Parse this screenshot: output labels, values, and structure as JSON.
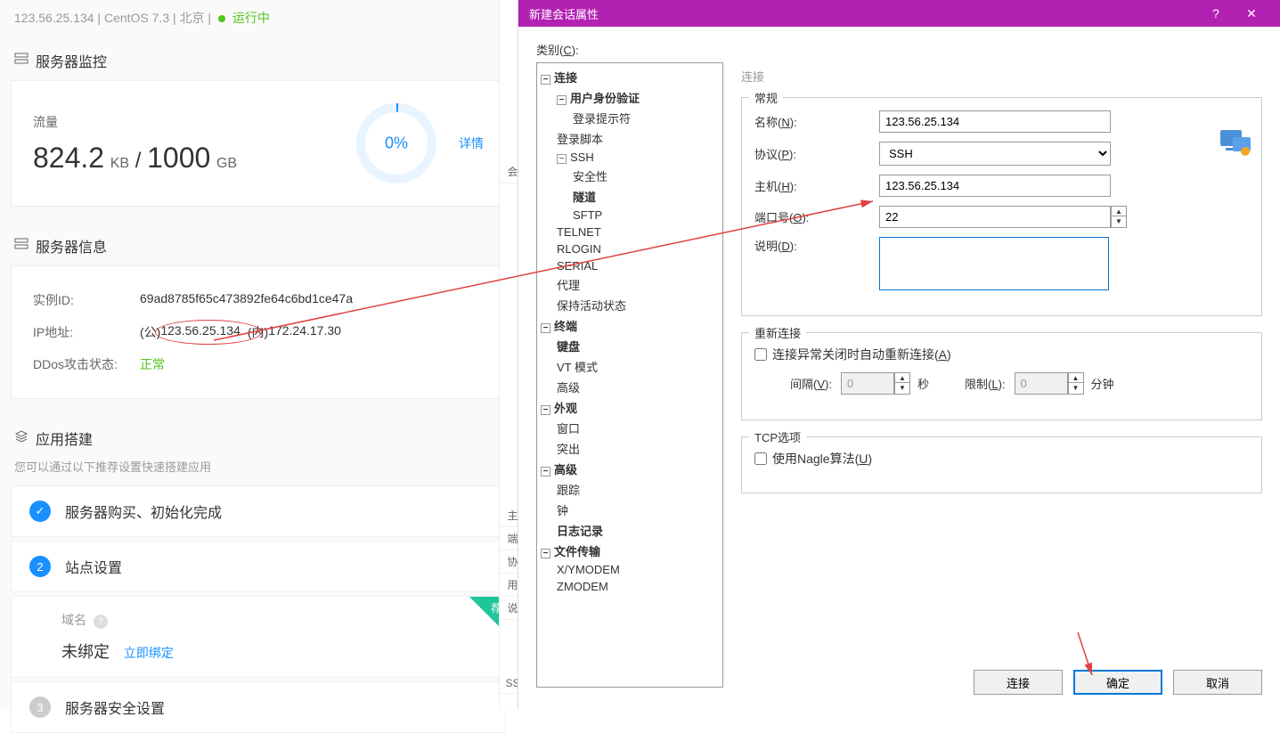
{
  "server_header": {
    "ip": "123.56.25.134",
    "os": "CentOS 7.3",
    "region": "北京",
    "status": "运行中"
  },
  "sections": {
    "monitor": "服务器监控",
    "info": "服务器信息",
    "build": "应用搭建"
  },
  "traffic": {
    "label": "流量",
    "used": "824.2",
    "used_unit": "KB",
    "slash": "/",
    "total": "1000",
    "total_unit": "GB",
    "percent": "0%",
    "detail_link": "详情"
  },
  "info": {
    "instance_id_label": "实例ID:",
    "instance_id": "69ad8785f65c473892fe64c6bd1ce47a",
    "ip_label": "IP地址:",
    "ip_public_prefix": "(公)",
    "ip_public": "123.56.25.134",
    "ip_private_prefix": "(内)",
    "ip_private": "172.24.17.30",
    "ddos_label": "DDos攻击状态:",
    "ddos_status": "正常"
  },
  "build": {
    "hint": "您可以通过以下推荐设置快速搭建应用",
    "step1": "服务器购买、初始化完成",
    "step2": "站点设置",
    "step3": "服务器安全设置",
    "domain_label": "域名",
    "unbound": "未绑定",
    "bind_link": "立即绑定",
    "badge": "荐"
  },
  "peek_items": [
    "会",
    "主",
    "端",
    "协",
    "用",
    "说",
    "SS"
  ],
  "dialog": {
    "title": "新建会话属性",
    "category_label": "类别(C):",
    "tree": {
      "connection": "连接",
      "auth": "用户身份验证",
      "login_prompt": "登录提示符",
      "login_script": "登录脚本",
      "ssh": "SSH",
      "security": "安全性",
      "tunnel": "隧道",
      "sftp": "SFTP",
      "telnet": "TELNET",
      "rlogin": "RLOGIN",
      "serial": "SERIAL",
      "proxy": "代理",
      "keepalive": "保持活动状态",
      "terminal": "终端",
      "keyboard": "键盘",
      "vtmode": "VT 模式",
      "advanced": "高级",
      "appearance": "外观",
      "window": "窗口",
      "highlight": "突出",
      "advanced2": "高级",
      "trace": "跟踪",
      "bell": "钟",
      "log": "日志记录",
      "filetransfer": "文件传输",
      "xymodem": "X/YMODEM",
      "zmodem": "ZMODEM"
    },
    "form": {
      "panel_title": "连接",
      "general_legend": "常规",
      "name_label": "名称(N):",
      "name_value": "123.56.25.134",
      "protocol_label": "协议(P):",
      "protocol_value": "SSH",
      "host_label": "主机(H):",
      "host_value": "123.56.25.134",
      "port_label": "端口号(O):",
      "port_value": "22",
      "desc_label": "说明(D):",
      "desc_value": "",
      "reconnect_legend": "重新连接",
      "reconnect_check": "连接异常关闭时自动重新连接(A)",
      "interval_label": "间隔(V):",
      "interval_value": "0",
      "interval_unit": "秒",
      "limit_label": "限制(L):",
      "limit_value": "0",
      "limit_unit": "分钟",
      "tcp_legend": "TCP选项",
      "nagle_check": "使用Nagle算法(U)"
    },
    "buttons": {
      "connect": "连接",
      "ok": "确定",
      "cancel": "取消"
    }
  }
}
